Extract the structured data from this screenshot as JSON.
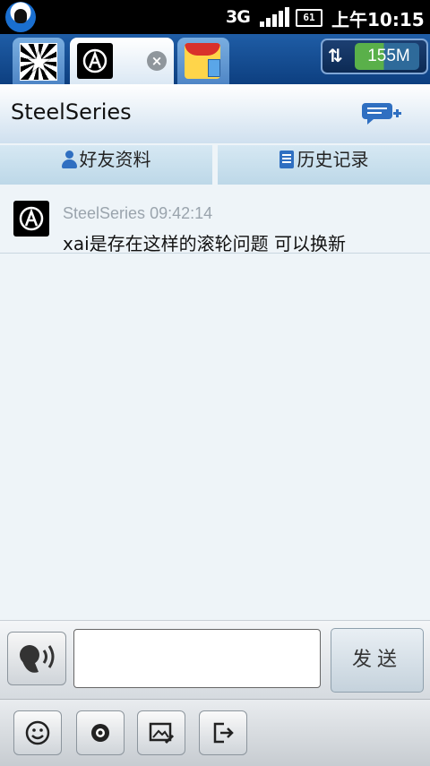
{
  "status_bar": {
    "network": "3G",
    "battery": "61",
    "time": "上午10:15"
  },
  "tabs": {
    "traffic": "155M",
    "close_symbol": "×"
  },
  "header": {
    "title": "SteelSeries"
  },
  "subtabs": [
    {
      "label": "好友资料",
      "icon": "person-icon"
    },
    {
      "label": "历史记录",
      "icon": "history-book-icon"
    }
  ],
  "messages": [
    {
      "sender": "SteelSeries",
      "time": "09:42:14",
      "text": "xai是存在这样的滚轮问题 可以换新"
    }
  ],
  "input": {
    "value": "",
    "send_label": "发送"
  },
  "toolbar": {
    "icons": [
      "emoji-icon",
      "record-icon",
      "image-edit-icon",
      "exit-icon"
    ]
  }
}
